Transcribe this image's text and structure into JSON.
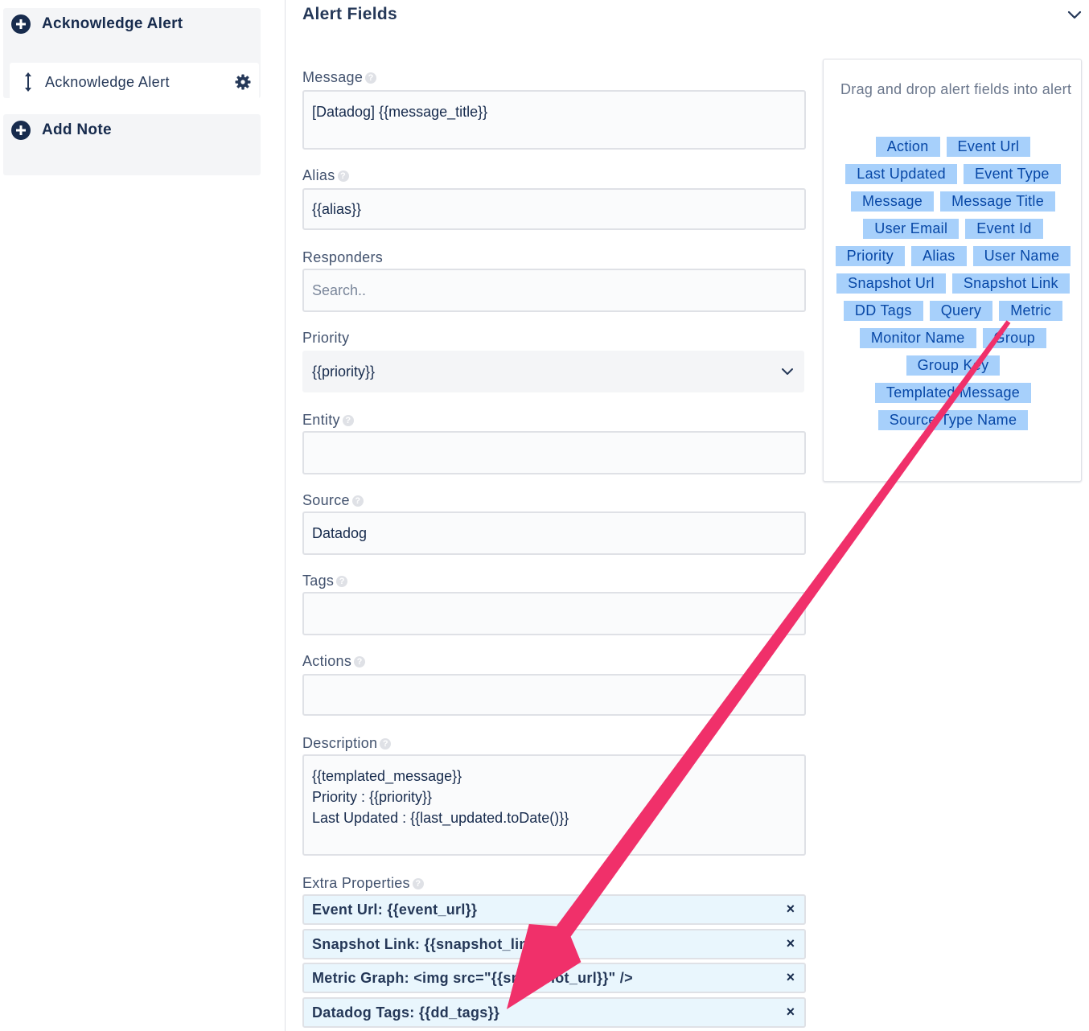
{
  "sidebar": {
    "cards": [
      {
        "title": "Acknowledge Alert",
        "subitem": "Acknowledge Alert"
      },
      {
        "title": "Add Note"
      }
    ]
  },
  "section": {
    "title": "Alert Fields"
  },
  "fields": {
    "message": {
      "label": "Message",
      "value_lines": [
        "[Datadog] {{message_title}}"
      ]
    },
    "alias": {
      "label": "Alias",
      "value": "{{alias}}"
    },
    "responders": {
      "label": "Responders",
      "placeholder": "Search.."
    },
    "priority": {
      "label": "Priority",
      "value": "{{priority}}"
    },
    "entity": {
      "label": "Entity",
      "value": ""
    },
    "source": {
      "label": "Source",
      "value": "Datadog"
    },
    "tags": {
      "label": "Tags",
      "value": ""
    },
    "actions": {
      "label": "Actions",
      "value": ""
    },
    "description": {
      "label": "Description",
      "value_lines": [
        "{{templated_message}}",
        "Priority : {{priority}}",
        "Last Updated : {{last_updated.toDate()}}"
      ]
    },
    "extra_properties": {
      "label": "Extra Properties",
      "items": [
        "Event Url: {{event_url}}",
        "Snapshot Link: {{snapshot_link}}",
        "Metric Graph: <img src=\"{{snapshot_url}}\" />",
        "Datadog Tags: {{dd_tags}}"
      ],
      "remove_symbol": "×"
    }
  },
  "drag_panel": {
    "hint": "Drag and drop alert fields into alert",
    "chips": [
      "Action",
      "Event Url",
      "Last Updated",
      "Event Type",
      "Message",
      "Message Title",
      "User Email",
      "Event Id",
      "Priority",
      "Alias",
      "User Name",
      "Snapshot Url",
      "Snapshot Link",
      "DD Tags",
      "Query",
      "Metric",
      "Monitor Name",
      "Group",
      "Group Key",
      "Templated Message",
      "Source Type Name"
    ]
  },
  "help_symbol": "?",
  "colors": {
    "arrow": "#f0306a",
    "chip_bg": "#a7d0fb",
    "chip_text": "#0747a6",
    "prop_bg": "#e9f6fd"
  }
}
